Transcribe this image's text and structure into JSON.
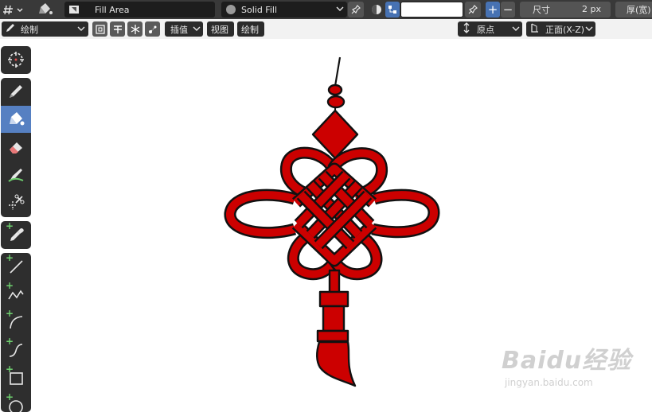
{
  "header": {
    "fill_area_label": "Fill Area",
    "material_label": "Solid Fill",
    "size_label": "尺寸",
    "size_value": "2 px",
    "thickness_label": "厚(宽)",
    "plus_label": "+",
    "minus_label": "−"
  },
  "toolbar2": {
    "mode_label": "绘制",
    "interp_label": "插值",
    "view_label": "视图",
    "draw_label": "绘制",
    "origin_label": "原点",
    "plane_label": "正面(X-Z)"
  },
  "tools": [
    {
      "name": "cursor-tool",
      "icon": "cursor-icon",
      "active": false
    },
    {
      "name": "draw-tool",
      "icon": "pencil-icon",
      "active": false
    },
    {
      "name": "fill-tool",
      "icon": "bucket-icon",
      "active": true
    },
    {
      "name": "erase-tool",
      "icon": "eraser-icon",
      "active": false
    },
    {
      "name": "tint-tool",
      "icon": "tint-icon",
      "active": false
    },
    {
      "name": "cutter-tool",
      "icon": "scissors-icon",
      "active": false
    },
    {
      "name": "eyedropper-tool",
      "icon": "eyedropper-icon",
      "active": false
    },
    {
      "name": "line-tool",
      "icon": "line-icon",
      "active": false
    },
    {
      "name": "polyline-tool",
      "icon": "polyline-icon",
      "active": false
    },
    {
      "name": "arc-tool",
      "icon": "arc-icon",
      "active": false
    },
    {
      "name": "curve-tool",
      "icon": "curve-icon",
      "active": false
    },
    {
      "name": "box-tool",
      "icon": "box-icon",
      "active": false
    },
    {
      "name": "circle-tool",
      "icon": "circle-icon",
      "active": false
    }
  ],
  "colors": {
    "knot_red": "#cc0000",
    "outline": "#111111",
    "active_tool": "#5680c2",
    "header_bg": "#393939"
  },
  "watermark": {
    "main": "Baidu经验",
    "sub": "jingyan.baidu.com"
  }
}
